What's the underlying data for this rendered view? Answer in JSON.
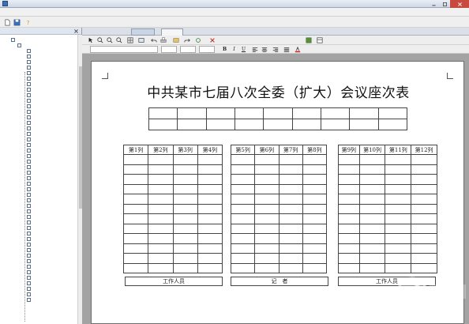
{
  "window": {
    "title": ""
  },
  "menu": {
    "items": [
      "",
      "",
      "",
      ""
    ]
  },
  "left_panel": {
    "header": "",
    "root_label": "",
    "group_label": "",
    "items": [
      "",
      "",
      "",
      "",
      "",
      "",
      "",
      "",
      "",
      "",
      "",
      "",
      "",
      "",
      "",
      "",
      "",
      "",
      "",
      "",
      "",
      "",
      "",
      "",
      "",
      "",
      "",
      "",
      "",
      "",
      "",
      "",
      "",
      "",
      "",
      "",
      "",
      "",
      "",
      "",
      "",
      "",
      "",
      "",
      "",
      ""
    ]
  },
  "tabs": [
    "",
    ""
  ],
  "format_bar": {
    "font_name": "",
    "size_a": "",
    "size_b": "",
    "size_c": "",
    "bold": "B",
    "italic": "I",
    "underline": "U"
  },
  "toolbar2": {
    "text_a": "",
    "text_b": "",
    "text_c": ""
  },
  "document": {
    "title": "中共某市七届八次全委（扩大）会议座次表",
    "top_rows": [
      [
        "",
        "",
        "",
        "",
        "",
        "",
        "",
        "",
        ""
      ],
      [
        "",
        "",
        "",
        "",
        "",
        "",
        "",
        "",
        ""
      ]
    ],
    "blocks": [
      {
        "headers": [
          "第1列",
          "第2列",
          "第3列",
          "第4列"
        ],
        "rows": [
          [
            "",
            "",
            "",
            ""
          ],
          [
            "",
            "",
            "",
            ""
          ],
          [
            "",
            "",
            "",
            ""
          ],
          [
            "",
            "",
            "",
            ""
          ],
          [
            "",
            "",
            "",
            ""
          ],
          [
            "",
            "",
            "",
            ""
          ],
          [
            "",
            "",
            "",
            ""
          ],
          [
            "",
            "",
            "",
            ""
          ],
          [
            "",
            "",
            "",
            ""
          ],
          [
            "",
            "",
            "",
            ""
          ],
          [
            "",
            "",
            "",
            ""
          ],
          [
            "",
            "",
            "",
            ""
          ]
        ]
      },
      {
        "headers": [
          "第5列",
          "第6列",
          "第7列",
          "第8列"
        ],
        "rows": [
          [
            "",
            "",
            "",
            ""
          ],
          [
            "",
            "",
            "",
            ""
          ],
          [
            "",
            "",
            "",
            ""
          ],
          [
            "",
            "",
            "",
            ""
          ],
          [
            "",
            "",
            "",
            ""
          ],
          [
            "",
            "",
            "",
            ""
          ],
          [
            "",
            "",
            "",
            ""
          ],
          [
            "",
            "",
            "",
            ""
          ],
          [
            "",
            "",
            "",
            ""
          ],
          [
            "",
            "",
            "",
            ""
          ],
          [
            "",
            "",
            "",
            ""
          ],
          [
            "",
            "",
            "",
            ""
          ]
        ]
      },
      {
        "headers": [
          "第9列",
          "第10列",
          "第11列",
          "第12列"
        ],
        "rows": [
          [
            "",
            "",
            "",
            ""
          ],
          [
            "",
            "",
            "",
            ""
          ],
          [
            "",
            "",
            "",
            ""
          ],
          [
            "",
            "",
            "",
            ""
          ],
          [
            "",
            "",
            "",
            ""
          ],
          [
            "",
            "",
            "",
            ""
          ],
          [
            "",
            "",
            "",
            ""
          ],
          [
            "",
            "",
            "",
            ""
          ],
          [
            "",
            "",
            "",
            ""
          ],
          [
            "",
            "",
            "",
            ""
          ],
          [
            "",
            "",
            "",
            ""
          ],
          [
            "",
            "",
            "",
            ""
          ]
        ]
      }
    ],
    "footer": {
      "left": "工作人员",
      "middle": "记　者",
      "right": "工作人员"
    }
  },
  "colors": {
    "accent": "#3c6fb5",
    "close": "#c84a3f"
  }
}
